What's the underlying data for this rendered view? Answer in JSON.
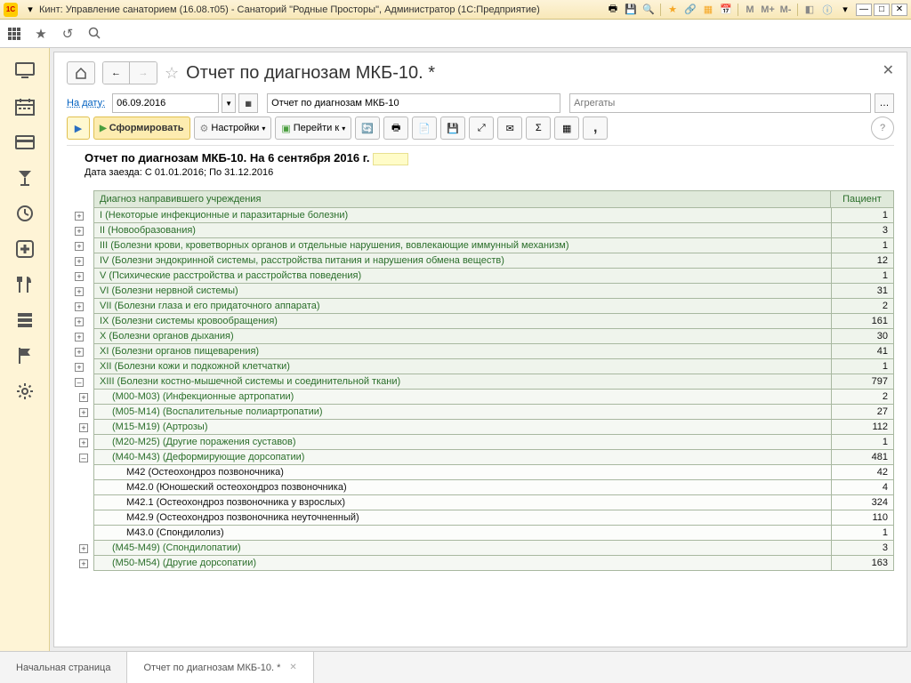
{
  "titlebar": {
    "logo": "1C",
    "title": "Кинт: Управление санаторием (16.08.т05) - Санаторий \"Родные Просторы\", Администратор  (1С:Предприятие)",
    "memory_buttons": [
      "M",
      "M+",
      "M-"
    ]
  },
  "page": {
    "title": "Отчет по диагнозам МКБ-10. *"
  },
  "params": {
    "date_label": "На дату:",
    "date_value": "06.09.2016",
    "report_name": "Отчет по диагнозам МКБ-10",
    "aggregates_placeholder": "Агрегаты"
  },
  "toolbar": {
    "form_label": "Сформировать",
    "settings_label": "Настройки",
    "goto_label": "Перейти к"
  },
  "report": {
    "title": "Отчет по диагнозам МКБ-10. На 6 сентября 2016 г.",
    "date_range": "Дата заезда: С 01.01.2016; По 31.12.2016",
    "col_diagnosis": "Диагноз направившего учреждения",
    "col_patient": "Пациент",
    "rows": [
      {
        "level": 0,
        "exp": "+",
        "diag": "I (Некоторые инфекционные и паразитарные болезни)",
        "pat": "1"
      },
      {
        "level": 0,
        "exp": "+",
        "diag": "II (Новообразования)",
        "pat": "3"
      },
      {
        "level": 0,
        "exp": "+",
        "diag": "III (Болезни крови, кроветворных органов и отдельные нарушения, вовлекающие иммунный механизм)",
        "pat": "1"
      },
      {
        "level": 0,
        "exp": "+",
        "diag": "IV (Болезни эндокринной системы, расстройства питания и нарушения обмена веществ)",
        "pat": "12"
      },
      {
        "level": 0,
        "exp": "+",
        "diag": "V (Психические расстройства и расстройства поведения)",
        "pat": "1"
      },
      {
        "level": 0,
        "exp": "+",
        "diag": "VI (Болезни нервной системы)",
        "pat": "31"
      },
      {
        "level": 0,
        "exp": "+",
        "diag": "VII (Болезни глаза и его придаточного аппарата)",
        "pat": "2"
      },
      {
        "level": 0,
        "exp": "+",
        "diag": "IX (Болезни системы кровообращения)",
        "pat": "161"
      },
      {
        "level": 0,
        "exp": "+",
        "diag": "X (Болезни органов дыхания)",
        "pat": "30"
      },
      {
        "level": 0,
        "exp": "+",
        "diag": "XI (Болезни органов пищеварения)",
        "pat": "41"
      },
      {
        "level": 0,
        "exp": "+",
        "diag": "XII (Болезни кожи и подкожной клетчатки)",
        "pat": "1"
      },
      {
        "level": 0,
        "exp": "–",
        "diag": "XIII (Болезни костно-мышечной системы и соединительной ткани)",
        "pat": "797"
      },
      {
        "level": 1,
        "exp": "+",
        "diag": "(M00-M03) (Инфекционные артропатии)",
        "pat": "2"
      },
      {
        "level": 1,
        "exp": "+",
        "diag": "(M05-M14) (Воспалительные полиартропатии)",
        "pat": "27"
      },
      {
        "level": 1,
        "exp": "+",
        "diag": "(M15-M19) (Артрозы)",
        "pat": "112"
      },
      {
        "level": 1,
        "exp": "+",
        "diag": "(M20-M25) (Другие поражения суставов)",
        "pat": "1"
      },
      {
        "level": 1,
        "exp": "–",
        "diag": "(M40-M43) (Деформирующие дорсопатии)",
        "pat": "481"
      },
      {
        "level": 2,
        "exp": "",
        "diag": "M42 (Остеохондроз позвоночника)",
        "pat": "42"
      },
      {
        "level": 2,
        "exp": "",
        "diag": "M42.0 (Юношеский остеохондроз позвоночника)",
        "pat": "4"
      },
      {
        "level": 2,
        "exp": "",
        "diag": "M42.1 (Остеохондроз позвоночника у взрослых)",
        "pat": "324"
      },
      {
        "level": 2,
        "exp": "",
        "diag": "M42.9 (Остеохондроз позвоночника неуточненный)",
        "pat": "110"
      },
      {
        "level": 2,
        "exp": "",
        "diag": "M43.0 (Спондилолиз)",
        "pat": "1"
      },
      {
        "level": 1,
        "exp": "+",
        "diag": "(M45-M49) (Спондилопатии)",
        "pat": "3"
      },
      {
        "level": 1,
        "exp": "+",
        "diag": "(M50-M54) (Другие дорсопатии)",
        "pat": "163"
      }
    ]
  },
  "tabs": {
    "start": "Начальная страница",
    "report": "Отчет по диагнозам МКБ-10. *"
  }
}
